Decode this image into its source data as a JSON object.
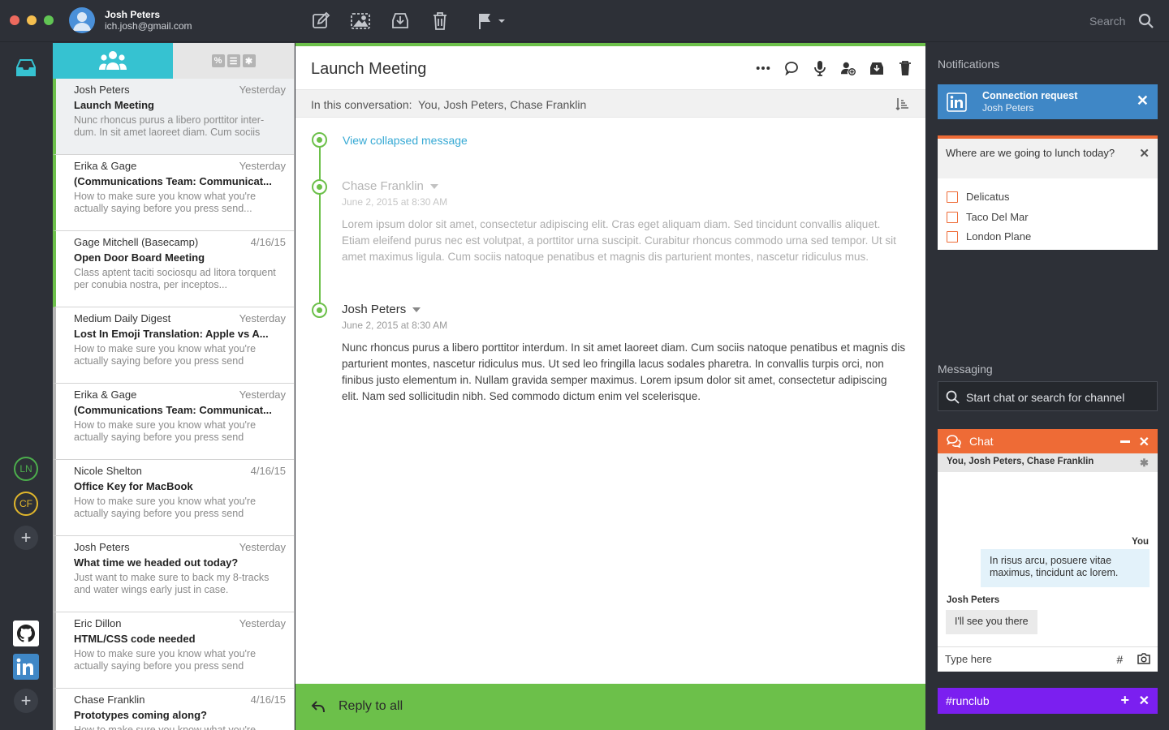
{
  "colors": {
    "close": "#ed6a5e",
    "minimize": "#f5bf4f",
    "zoom": "#61c554",
    "accent_green": "#6cc04a",
    "accent_cyan": "#36c2d1",
    "accent_orange": "#ee6b36",
    "linkedin_blue": "#3f87c6",
    "runclub_purple": "#7b1ff0",
    "ln_ring": "#4cae4c",
    "cf_ring": "#e0b62c"
  },
  "account": {
    "name": "Josh Peters",
    "email": "ich.josh@gmail.com"
  },
  "toolbar": {
    "icons": [
      "compose-icon",
      "image-icon",
      "archive-download-icon",
      "trash-icon",
      "flag-icon"
    ],
    "search_label": "Search"
  },
  "rail": {
    "top_icon": "inbox-icon",
    "contacts": [
      "LN",
      "CF"
    ],
    "apps": [
      "github-icon",
      "linkedin-icon"
    ]
  },
  "list": {
    "tab_icons": [
      "people-icon",
      "percent-icon",
      "newsletter-icon",
      "asterisk-icon"
    ],
    "tab_glyphs": [
      "%",
      "☰",
      "✱"
    ],
    "messages": [
      {
        "sender": "Josh Peters",
        "date": "Yesterday",
        "subject": "Launch Meeting",
        "preview": "Nunc rhoncus purus a libero porttitor inter-dum. In sit amet laoreet diam. Cum sociis",
        "accent": "#6cc04a",
        "selected": true
      },
      {
        "sender": "Erika & Gage",
        "date": "Yesterday",
        "subject": "(Communications Team: Communicat...",
        "preview": "How to make sure you know what you're actually saying before you press send...",
        "accent": "#6cc04a",
        "selected": false
      },
      {
        "sender": "Gage Mitchell (Basecamp)",
        "date": "4/16/15",
        "subject": "Open Door Board Meeting",
        "preview": "Class aptent taciti sociosqu ad litora torquent per conubia nostra, per inceptos...",
        "accent": "#6cc04a",
        "selected": false
      },
      {
        "sender": "Medium Daily Digest",
        "date": "Yesterday",
        "subject": "Lost In Emoji Translation: Apple vs A...",
        "preview": "How to make sure you know what you're actually saying before you press send",
        "accent": "#b5b5b5",
        "selected": false
      },
      {
        "sender": "Erika & Gage",
        "date": "Yesterday",
        "subject": "(Communications Team: Communicat...",
        "preview": "How to make sure you know what you're actually saying before you press send",
        "accent": "#b5b5b5",
        "selected": false
      },
      {
        "sender": "Nicole Shelton",
        "date": "4/16/15",
        "subject": "Office Key for MacBook",
        "preview": "How to make sure you know what you're actually saying before you press send",
        "accent": "#b5b5b5",
        "selected": false
      },
      {
        "sender": "Josh Peters",
        "date": "Yesterday",
        "subject": "What time we headed out today?",
        "preview": "Just want to make sure to back my 8-tracks and water wings early just in case.",
        "accent": "#b5b5b5",
        "selected": false
      },
      {
        "sender": "Eric Dillon",
        "date": "Yesterday",
        "subject": "HTML/CSS code needed",
        "preview": "How to make sure you know what you're actually saying before you press send",
        "accent": "#b5b5b5",
        "selected": false
      },
      {
        "sender": "Chase Franklin",
        "date": "4/16/15",
        "subject": "Prototypes coming along?",
        "preview": "How to make sure you know what you're actually saying before you press send",
        "accent": "#b5b5b5",
        "selected": false
      }
    ]
  },
  "conversation": {
    "title": "Launch Meeting",
    "actions": [
      "more-icon",
      "comment-icon",
      "microphone-icon",
      "add-person-icon",
      "archive-icon",
      "trash-icon"
    ],
    "participants_label": "In this conversation:",
    "participants": "You, Josh Peters, Chase Franklin",
    "collapsed_link": "View collapsed message",
    "messages": [
      {
        "sender": "Chase Franklin",
        "date": "June 2, 2015 at 8:30 AM",
        "body": "Lorem ipsum dolor sit amet, consectetur adipiscing elit. Cras eget aliquam diam. Sed tincidunt convallis aliquet. Etiam eleifend purus nec est volutpat, a porttitor urna suscipit. Curabitur rhoncus commodo urna sed tempor. Ut sit amet maximus ligula. Cum sociis natoque penatibus et magnis dis parturient montes, nascetur ridiculus mus.",
        "faded": true
      },
      {
        "sender": "Josh Peters",
        "date": "June 2, 2015 at 8:30 AM",
        "body": "Nunc rhoncus purus a libero porttitor interdum. In sit amet laoreet diam. Cum sociis natoque penatibus et magnis dis parturient montes, nascetur ridiculus mus. Ut sed leo fringilla lacus sodales pharetra. In convallis turpis orci, non finibus justo elementum in. Nullam gravida semper maximus. Lorem ipsum dolor sit amet, consectetur adipiscing elit. Nam sed sollicitudin nibh. Sed commodo dictum enim vel scelerisque.",
        "faded": false
      }
    ],
    "reply_label": "Reply to all"
  },
  "notifications": {
    "title": "Notifications",
    "connection": {
      "title": "Connection request",
      "name": "Josh Peters"
    },
    "poll": {
      "question": "Where are we going to lunch today?",
      "options": [
        "Delicatus",
        "Taco Del Mar",
        "London Plane"
      ]
    }
  },
  "messaging": {
    "title": "Messaging",
    "search_placeholder": "Start chat or search for channel",
    "chat": {
      "title": "Chat",
      "participants": "You, Josh Peters, Chase Franklin",
      "you_label": "You",
      "you_message": "In risus arcu, posuere vitae maximus, tincidunt ac lorem.",
      "other_label": "Josh Peters",
      "other_message": "I'll see you there",
      "input_placeholder": "Type here",
      "hash": "#"
    },
    "channel": {
      "name": "#runclub"
    }
  }
}
